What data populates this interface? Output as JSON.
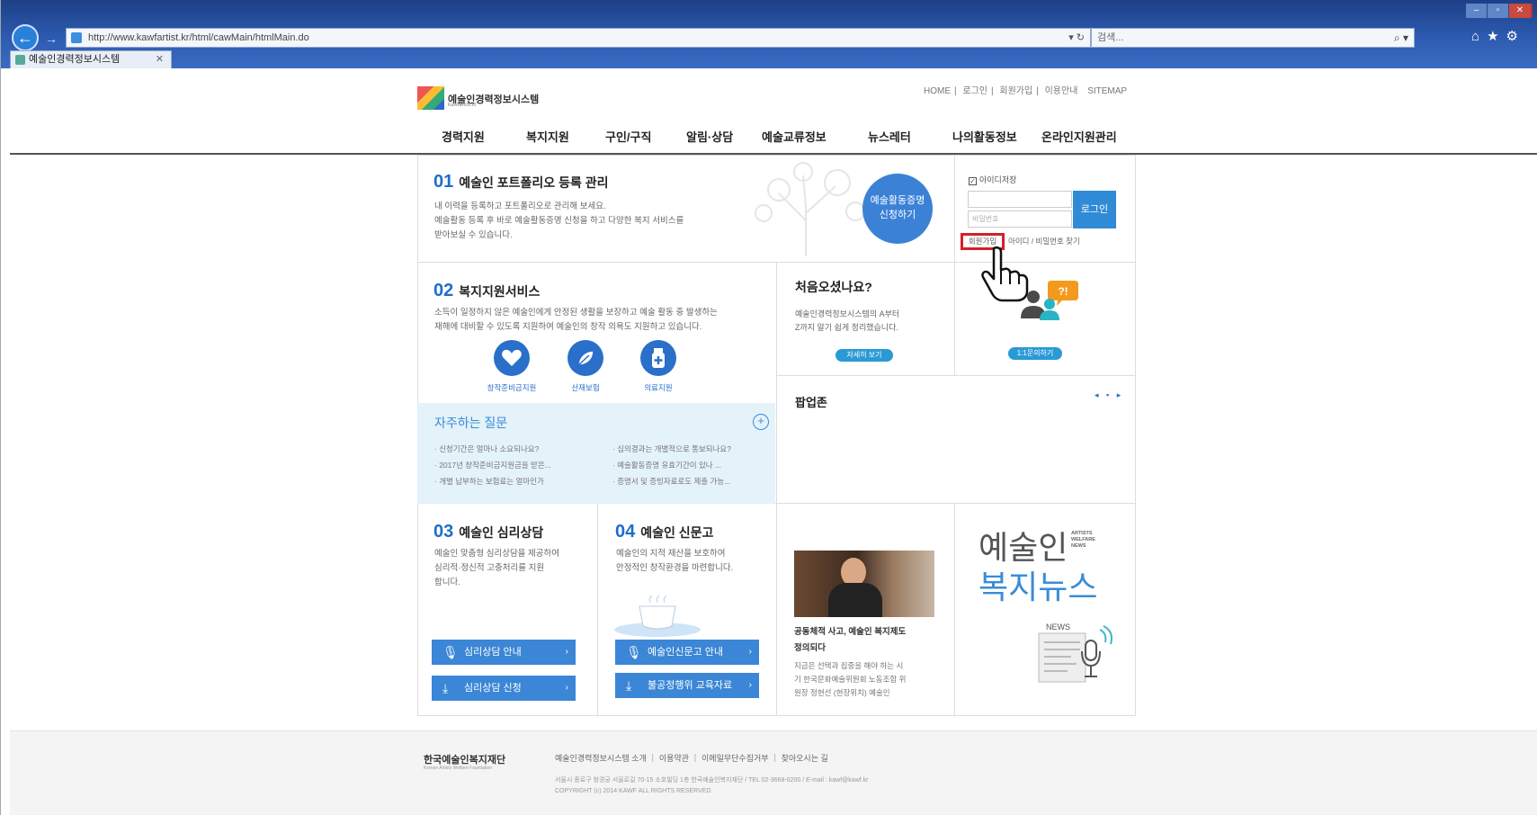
{
  "browser": {
    "url": "http://www.kawfartist.kr/html/cawMain/htmlMain.do",
    "search_placeholder": "검색...",
    "tab_title": "예술인경력정보시스템",
    "tab_close": "✕"
  },
  "header": {
    "logo_text": "예술인경력정보시스템",
    "logo_sub": "kawfartist.kr",
    "util_links": [
      "HOME",
      "로그인",
      "회원가입",
      "이용안내",
      "SITEMAP"
    ]
  },
  "gnb": [
    "경력지원",
    "복지지원",
    "구인/구직",
    "알림·상담",
    "예술교류정보",
    "뉴스레터",
    "나의활동정보",
    "온라인지원관리"
  ],
  "sec01": {
    "num": "01",
    "title": "예술인 포트폴리오 등록 관리",
    "desc": [
      "내 이력을 등록하고 포트폴리오로 관리해 보세요.",
      "예술활동 등록 후 바로 예술활동증명 신청을 하고 다양한 복지 서비스를",
      "받아보실 수 있습니다."
    ],
    "cta": [
      "예술활동증명",
      "신청하기"
    ]
  },
  "login": {
    "save_id": "아이디저장",
    "id_placeholder": "",
    "pw_placeholder": "비밀번호",
    "login_button": "로그인",
    "join_button": "회원가입",
    "find_link": "아이디 / 비밀번호 찾기"
  },
  "sec02": {
    "num": "02",
    "title": "복지지원서비스",
    "desc": [
      "소득이 일정하지 않은 예술인에게 안정된 생활을 보장하고 예술 활동 중 발생하는",
      "재해에 대비할 수 있도록 지원하여 예술인의 창작 의욕도 지원하고 있습니다."
    ],
    "icons": [
      {
        "label": "창작준비금지원",
        "icon": "heart-icon"
      },
      {
        "label": "산재보험",
        "icon": "leaf-icon"
      },
      {
        "label": "의료지원",
        "icon": "medical-icon"
      }
    ]
  },
  "first_visit": {
    "title": "처음오셨나요?",
    "desc": [
      "예술인경력정보시스템의 A부터",
      "Z까지 알기 쉽게 정리했습니다."
    ],
    "detail_button": "자세히 보기",
    "qa_button": "1:1문의하기"
  },
  "faq": {
    "title": "자주하는 질문",
    "left": [
      "신청기간은 얼마나 소요되나요?",
      "2017년 창작준비금지원금을 받은...",
      "개별 납부하는 보험료는 얼마인가"
    ],
    "right": [
      "심의결과는 개별적으로 통보되나요?",
      "예술활동증명 유효기간이 있나 ...",
      "증명서 및 증빙자료로도 제출 가능..."
    ]
  },
  "popup": {
    "title": "팝업존",
    "dots": "◂ ▪ ▸"
  },
  "sec03": {
    "num": "03",
    "title": "예술인 심리상담",
    "desc": [
      "예술인 맞춤형 심리상담을 제공하여",
      "심리적·정신적 고충처리를 지원",
      "합니다."
    ],
    "buttons": [
      "심리상담 안내",
      "심리상담 신청"
    ]
  },
  "sec04": {
    "num": "04",
    "title": "예술인 신문고",
    "desc": [
      "예술인의 지적 재산을 보호하여",
      "안정적인 창작환경을 마련합니다."
    ],
    "buttons": [
      "예술인신문고 안내",
      "불공정행위 교육자료"
    ]
  },
  "news": {
    "headline": [
      "공동체적 사고, 예술인 복지제도",
      "정의되다"
    ],
    "body": [
      "지금은 선택과 집중을 해야 하는 시",
      "기 한국문화예술위원회 노동조합 위",
      "원장 정현선  (현장위치) 예술인"
    ]
  },
  "brand": {
    "line1": "예술인",
    "line2": "복지뉴스",
    "tag": [
      "ARTISTS",
      "WELFARE",
      "NEWS"
    ],
    "news_badge": "NEWS"
  },
  "footer": {
    "brand": "한국예술인복지재단",
    "brand_sub": "Korean Artists Welfare Foundation",
    "links": [
      "예술인경력정보시스템 소개",
      "이용약관",
      "이메일무단수집거부",
      "찾아오시는 길"
    ],
    "address": "서울시 종로구 창경궁 서울로길 70-15 소호빌딩 1층 한국예술인복지재단 / TEL 02-3668-0200 / E-mail : kawf@kawf.kr",
    "copyright": "COPYRIGHT (c) 2014 KAWF ALL RIGHTS RESERVED."
  }
}
